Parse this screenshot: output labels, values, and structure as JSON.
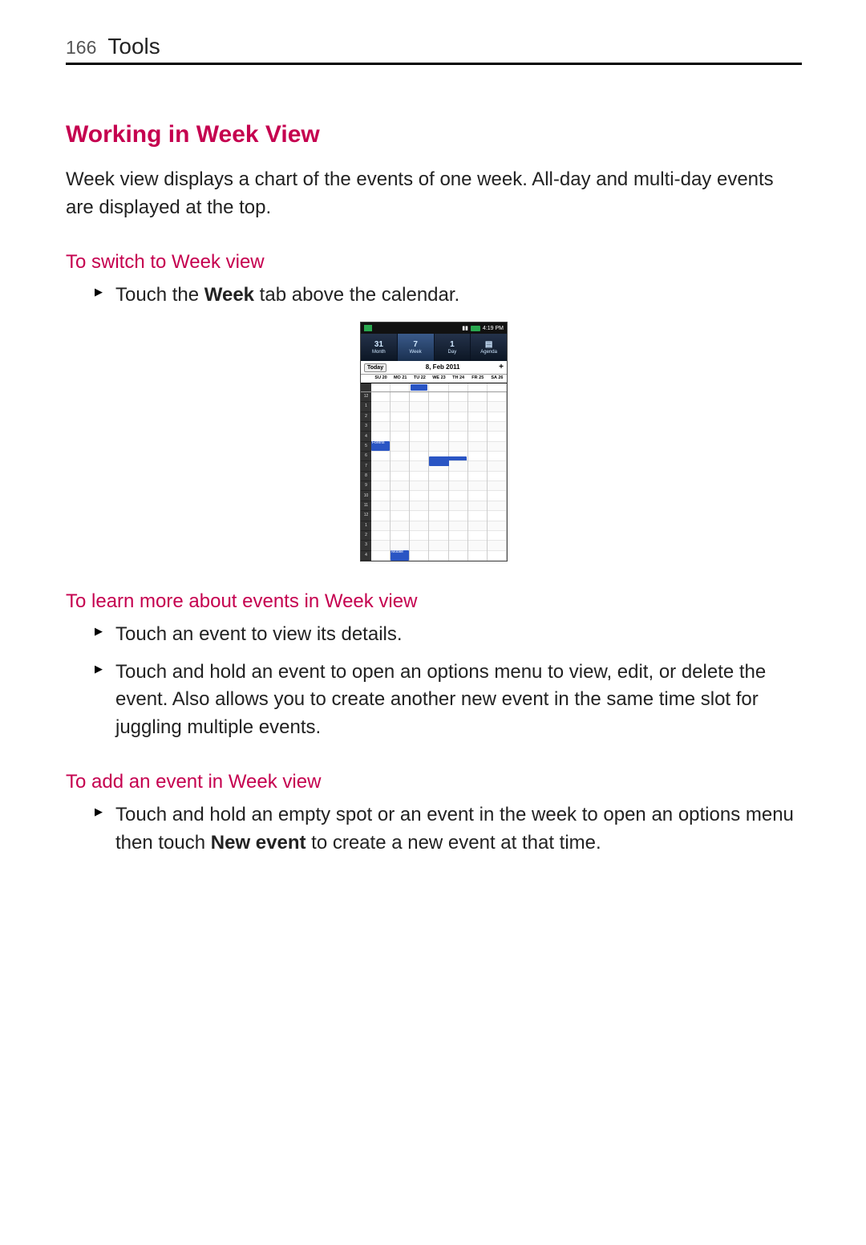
{
  "header": {
    "page_number": "166",
    "section": "Tools"
  },
  "heading": "Working in Week View",
  "intro": "Week view displays a chart of the events of one week. All-day and multi-day events are displayed at the top.",
  "sub1": {
    "title": "To switch to Week view",
    "item1_prefix": "Touch the ",
    "item1_bold": "Week",
    "item1_suffix": " tab above the calendar."
  },
  "sub2": {
    "title": "To learn more about events in Week view",
    "item1": "Touch an event to view its details.",
    "item2": "Touch and hold an event to open an options menu to view, edit, or delete the event. Also allows you to create another new event in the same time slot for juggling multiple events."
  },
  "sub3": {
    "title": "To add an event in Week view",
    "item1_prefix": "Touch and hold an empty spot or an event in the week to open an options menu then touch ",
    "item1_bold": "New event",
    "item1_suffix": " to create a new event at that time."
  },
  "shot": {
    "time": "4:19 PM",
    "tabs": {
      "month": {
        "big": "31",
        "label": "Month"
      },
      "week": {
        "big": "7",
        "label": "Week"
      },
      "day": {
        "big": "1",
        "label": "Day"
      },
      "agenda": {
        "big": "",
        "label": "Agenda"
      }
    },
    "today": "Today",
    "date": "8, Feb 2011",
    "plus": "+",
    "days": [
      "SU 20",
      "MO 21",
      "TU 22",
      "WE 23",
      "TH 24",
      "FR 25",
      "SA 26"
    ],
    "hours": [
      "12",
      "1",
      "2",
      "3",
      "4",
      "5",
      "6",
      "7",
      "8",
      "9",
      "10",
      "11",
      "12",
      "1",
      "2",
      "3",
      "4"
    ],
    "event_allday_label": "",
    "event1_label": "Forens",
    "event2_label": "",
    "event3_label": "Mobile"
  }
}
